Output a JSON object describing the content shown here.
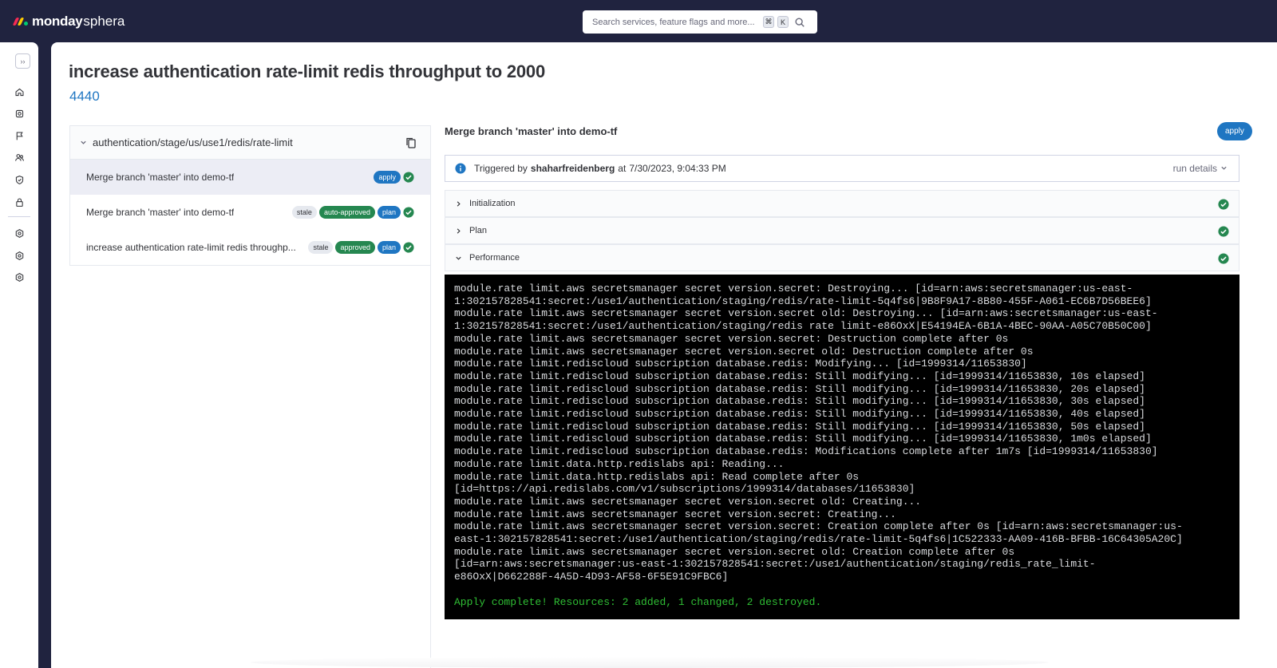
{
  "app": {
    "brand": "monday",
    "product": "sphera",
    "logo_colors": [
      "#f62b54",
      "#ffcb00",
      "#00ca72"
    ]
  },
  "search": {
    "placeholder": "Search services, feature flags and more...",
    "shortcut_keys": [
      "⌘",
      "K"
    ]
  },
  "sidebar": {
    "collapse_icon": "double-chevron-right-icon",
    "items": [
      {
        "icon": "home-icon"
      },
      {
        "icon": "gear-service-icon"
      },
      {
        "icon": "flag-icon"
      },
      {
        "icon": "users-icon"
      },
      {
        "icon": "shield-icon"
      },
      {
        "icon": "lock-icon"
      },
      {
        "icon": "gear-icon"
      },
      {
        "icon": "gear-icon"
      },
      {
        "icon": "gear-icon"
      }
    ]
  },
  "page": {
    "title": "increase authentication rate-limit redis throughput to 2000",
    "id": "4440"
  },
  "tree": {
    "path": "authentication/stage/us/use1/redis/rate-limit",
    "runs": [
      {
        "label": "Merge branch 'master' into demo-tf",
        "badges": [
          "apply"
        ],
        "status": "success",
        "selected": true
      },
      {
        "label": "Merge branch 'master' into demo-tf",
        "badges": [
          "stale",
          "auto-approved",
          "plan"
        ],
        "status": "success",
        "selected": false
      },
      {
        "label": "increase authentication rate-limit redis throughp...",
        "badges": [
          "stale",
          "approved",
          "plan"
        ],
        "status": "success",
        "selected": false
      }
    ]
  },
  "run": {
    "title": "Merge branch 'master' into demo-tf",
    "action_badge": "apply",
    "triggered_prefix": "Triggered by",
    "triggered_by": "shaharfreidenberg",
    "at_word": "at",
    "triggered_at": "7/30/2023, 9:04:33 PM",
    "run_details_label": "run details",
    "steps": [
      {
        "name": "Initialization",
        "expanded": false,
        "status": "success"
      },
      {
        "name": "Plan",
        "expanded": false,
        "status": "success"
      },
      {
        "name": "Performance",
        "expanded": true,
        "status": "success"
      }
    ],
    "log_lines": [
      "module.rate limit.aws secretsmanager secret version.secret: Destroying... [id=arn:aws:secretsmanager:us-east-",
      "1:302157828541:secret:/use1/authentication/staging/redis/rate-limit-5q4fs6|9B8F9A17-8B80-455F-A061-EC6B7D56BEE6]",
      "module.rate limit.aws secretsmanager secret version.secret old: Destroying... [id=arn:aws:secretsmanager:us-east-",
      "1:302157828541:secret:/use1/authentication/staging/redis rate limit-e86OxX|E54194EA-6B1A-4BEC-90AA-A05C70B50C00]",
      "module.rate limit.aws secretsmanager secret version.secret: Destruction complete after 0s",
      "module.rate limit.aws secretsmanager secret version.secret old: Destruction complete after 0s",
      "module.rate limit.rediscloud subscription database.redis: Modifying... [id=1999314/11653830]",
      "module.rate limit.rediscloud subscription database.redis: Still modifying... [id=1999314/11653830, 10s elapsed]",
      "module.rate limit.rediscloud subscription database.redis: Still modifying... [id=1999314/11653830, 20s elapsed]",
      "module.rate limit.rediscloud subscription database.redis: Still modifying... [id=1999314/11653830, 30s elapsed]",
      "module.rate limit.rediscloud subscription database.redis: Still modifying... [id=1999314/11653830, 40s elapsed]",
      "module.rate limit.rediscloud subscription database.redis: Still modifying... [id=1999314/11653830, 50s elapsed]",
      "module.rate limit.rediscloud subscription database.redis: Still modifying... [id=1999314/11653830, 1m0s elapsed]",
      "module.rate limit.rediscloud subscription database.redis: Modifications complete after 1m7s [id=1999314/11653830]",
      "module.rate limit.data.http.redislabs api: Reading...",
      "module.rate limit.data.http.redislabs api: Read complete after 0s",
      "[id=https://api.redislabs.com/v1/subscriptions/1999314/databases/11653830]",
      "module.rate limit.aws secretsmanager secret version.secret old: Creating...",
      "module.rate limit.aws secretsmanager secret version.secret: Creating...",
      "module.rate limit.aws secretsmanager secret version.secret: Creation complete after 0s [id=arn:aws:secretsmanager:us-",
      "east-1:302157828541:secret:/use1/authentication/staging/redis/rate-limit-5q4fs6|1C522333-AA09-416B-BFBB-16C64305A20C]",
      "module.rate limit.aws secretsmanager secret version.secret old: Creation complete after 0s",
      "[id=arn:aws:secretsmanager:us-east-1:302157828541:secret:/use1/authentication/staging/redis_rate_limit-",
      "e86OxX|D662288F-4A5D-4D93-AF58-6F5E91C9FBC6]"
    ],
    "log_summary": "Apply complete! Resources: 2 added, 1 changed, 2 destroyed."
  },
  "colors": {
    "topbar": "#20233f",
    "primary": "#1f76c2",
    "success": "#258750",
    "log_text": "#d8dadd",
    "log_success": "#2fbe34"
  }
}
